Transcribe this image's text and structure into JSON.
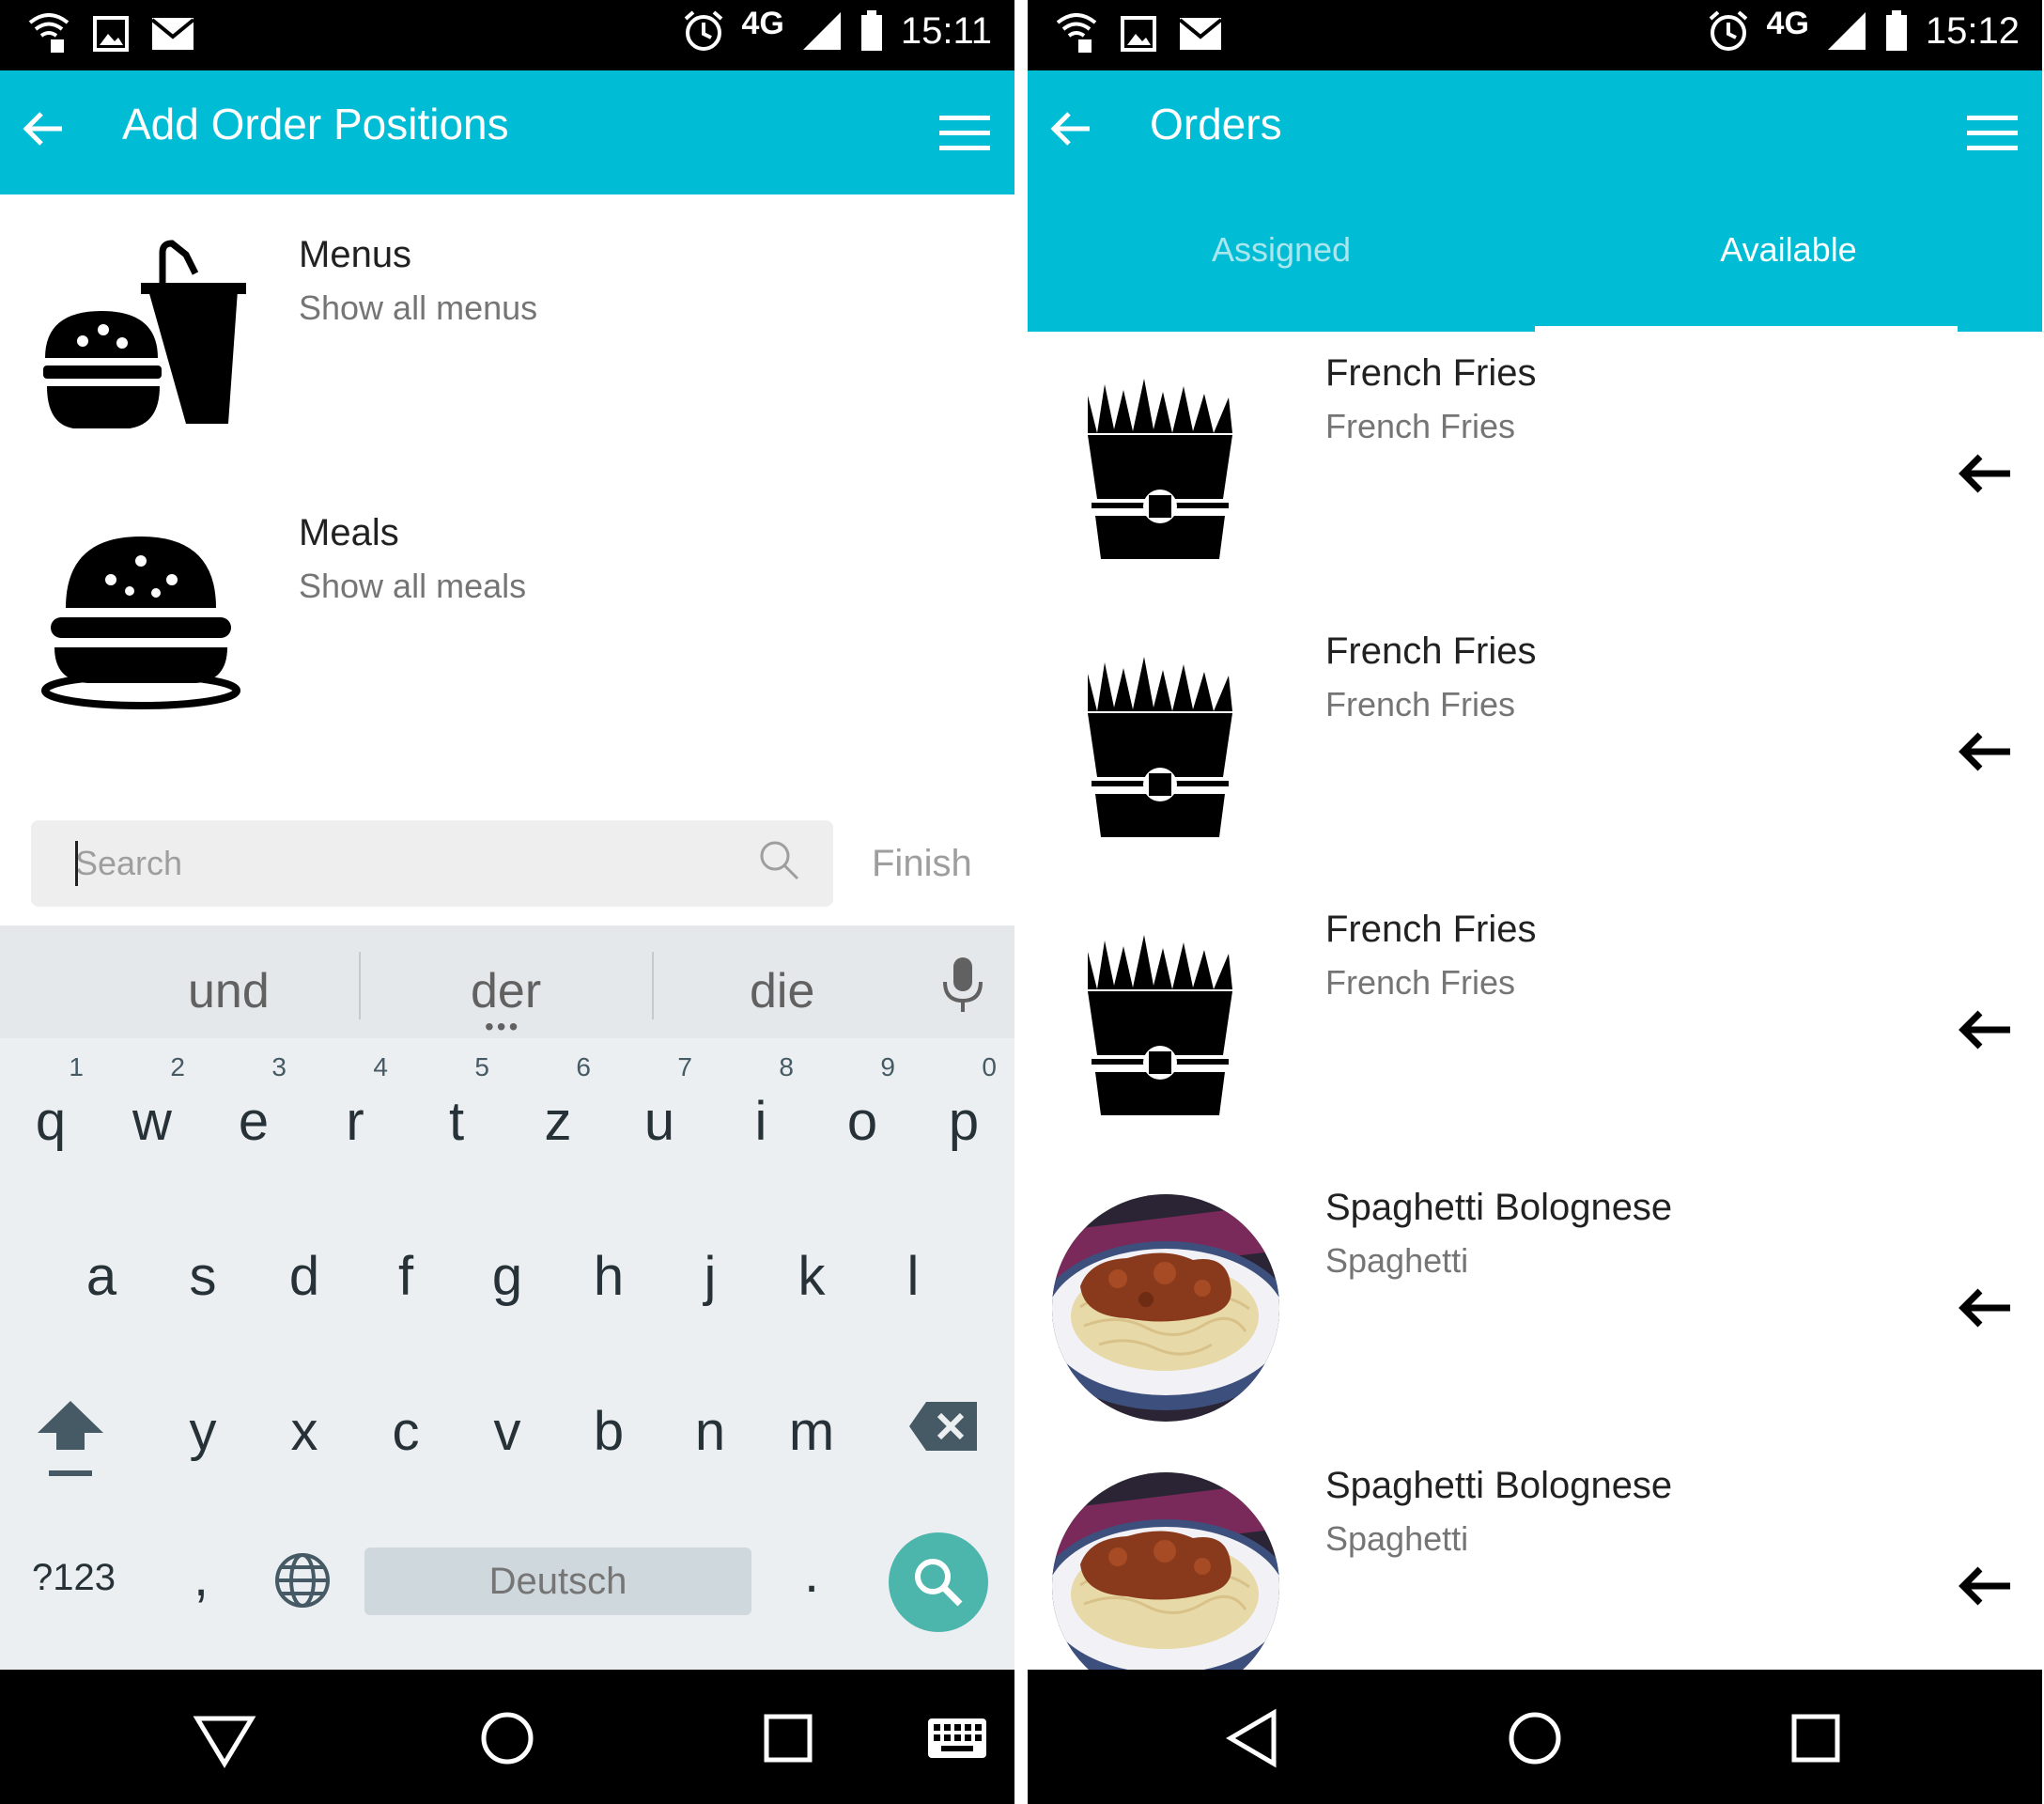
{
  "left": {
    "status": {
      "time": "15:11",
      "network": "4G"
    },
    "appbar": {
      "title": "Add Order Positions"
    },
    "list": [
      {
        "title": "Menus",
        "subtitle": "Show all menus",
        "icon": "burger-drink-icon"
      },
      {
        "title": "Meals",
        "subtitle": "Show all meals",
        "icon": "burger-icon"
      }
    ],
    "search": {
      "placeholder": "Search",
      "finish_label": "Finish"
    },
    "keyboard": {
      "suggestions": [
        "und",
        "der",
        "die"
      ],
      "row1": [
        "q",
        "w",
        "e",
        "r",
        "t",
        "z",
        "u",
        "i",
        "o",
        "p"
      ],
      "row1_hints": [
        "1",
        "2",
        "3",
        "4",
        "5",
        "6",
        "7",
        "8",
        "9",
        "0"
      ],
      "row2": [
        "a",
        "s",
        "d",
        "f",
        "g",
        "h",
        "j",
        "k",
        "l"
      ],
      "row3": [
        "y",
        "x",
        "c",
        "v",
        "b",
        "n",
        "m"
      ],
      "symbols_label": "?123",
      "comma": ",",
      "space_label": "Deutsch",
      "period": "."
    }
  },
  "right": {
    "status": {
      "time": "15:12",
      "network": "4G"
    },
    "appbar": {
      "title": "Orders"
    },
    "tabs": [
      "Assigned",
      "Available"
    ],
    "selected_tab": "Available",
    "list": [
      {
        "title": "French Fries",
        "subtitle": "French Fries",
        "icon": "french-fries-icon"
      },
      {
        "title": "French Fries",
        "subtitle": "French Fries",
        "icon": "french-fries-icon"
      },
      {
        "title": "French Fries",
        "subtitle": "French Fries",
        "icon": "french-fries-icon"
      },
      {
        "title": "Spaghetti Bolognese",
        "subtitle": "Spaghetti",
        "icon": "spaghetti-photo"
      },
      {
        "title": "Spaghetti Bolognese",
        "subtitle": "Spaghetti",
        "icon": "spaghetti-photo"
      }
    ]
  },
  "colors": {
    "primary": "#00bcd4",
    "accent": "#4db6ac",
    "keyboard_bg": "#eceff1"
  }
}
